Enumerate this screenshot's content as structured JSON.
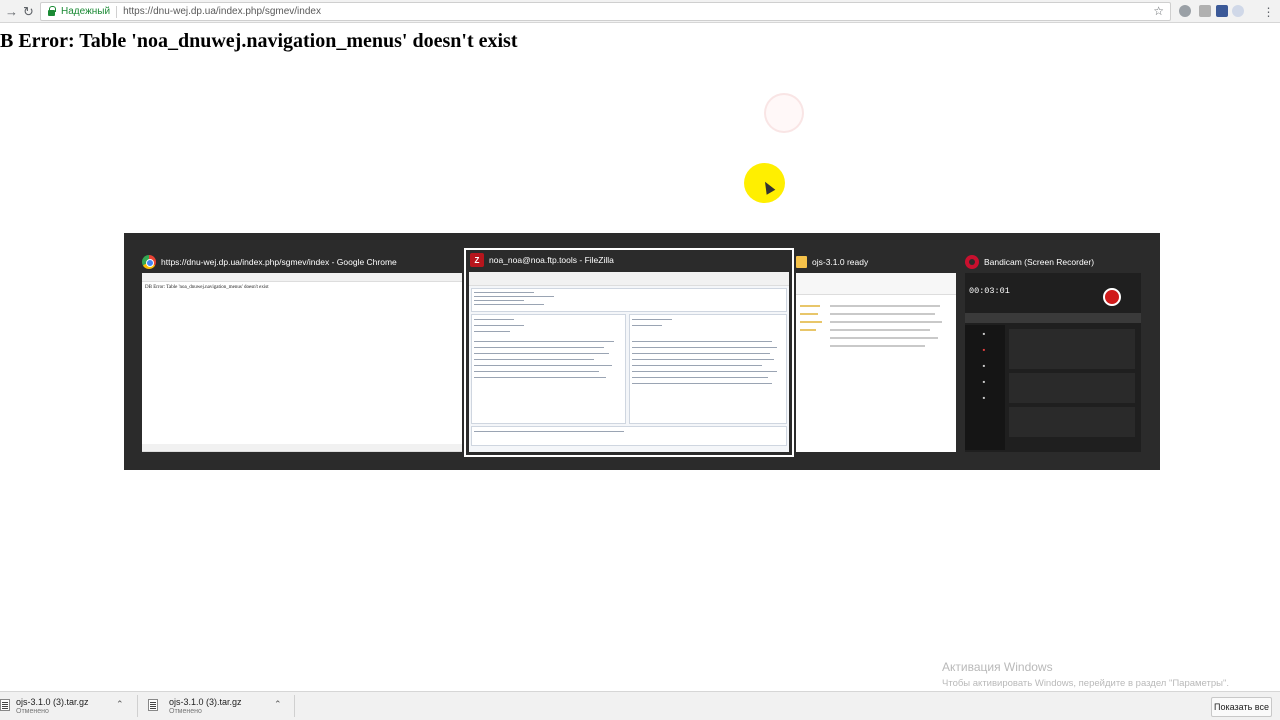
{
  "browser": {
    "secure_label": "Надежный",
    "url": "https://dnu-wej.dp.ua/index.php/sgmev/index"
  },
  "page": {
    "error_text": "B Error: Table 'noa_dnuwej.navigation_menus' doesn't exist"
  },
  "task_switcher": {
    "windows": [
      {
        "title": "https://dnu-wej.dp.ua/index.php/sgmev/index - Google Chrome",
        "icon": "chrome-icon",
        "thumb_text": "DB Error: Table 'noa_dnuwej.navigation_menus' doesn't exist"
      },
      {
        "title": "noa_noa@noa.ftp.tools - FileZilla",
        "icon": "filezilla-icon",
        "active": true
      },
      {
        "title": "ojs-3.1.0 ready",
        "icon": "folder-icon"
      },
      {
        "title": "Bandicam (Screen Recorder)",
        "icon": "bandicam-icon",
        "timer": "00:03:01"
      }
    ]
  },
  "windows_activation": {
    "title": "Активация Windows",
    "subtitle": "Чтобы активировать Windows, перейдите в раздел \"Параметры\"."
  },
  "downloads": {
    "items": [
      {
        "name": "ojs-3.1.0 (3).tar.gz",
        "status": "Отменено"
      },
      {
        "name": "ojs-3.1.0 (3).tar.gz",
        "status": "Отменено"
      }
    ],
    "show_all_label": "Показать все"
  }
}
